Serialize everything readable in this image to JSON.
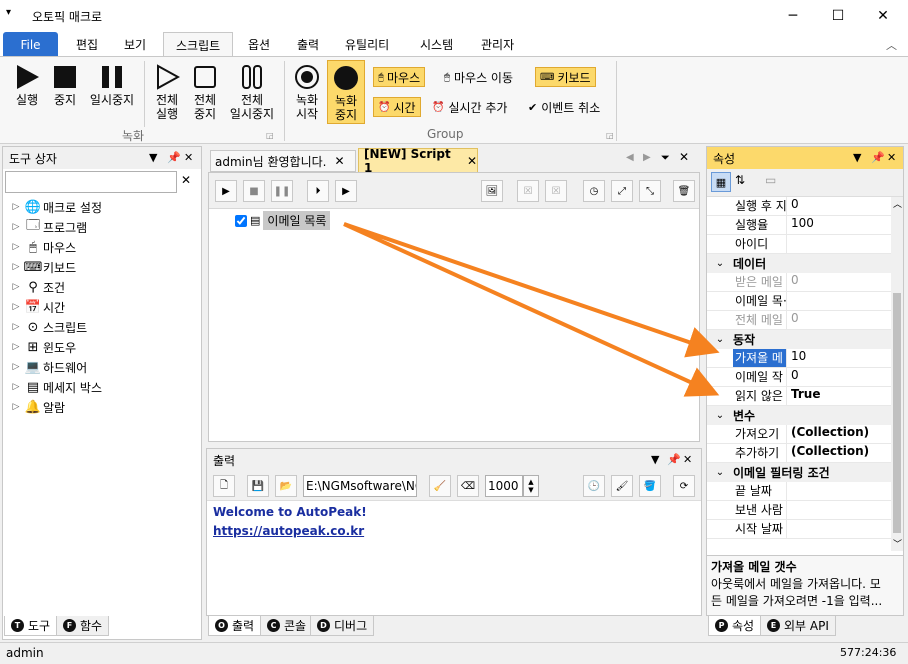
{
  "window": {
    "title": "오토픽 매크로",
    "min": "─",
    "max": "☐",
    "close": "✕"
  },
  "menu": {
    "tabs": [
      "File",
      "편집",
      "보기",
      "스크립트",
      "옵션",
      "출력",
      "유틸리티",
      "시스템",
      "관리자"
    ]
  },
  "ribbon": {
    "run": "실행",
    "stop": "중지",
    "pause": "일시중지",
    "all_run": [
      "전체",
      "실행"
    ],
    "all_stop": [
      "전체",
      "중지"
    ],
    "all_pause": [
      "전체",
      "일시중지"
    ],
    "rec_start": [
      "녹화",
      "시작"
    ],
    "rec_stop": [
      "녹화",
      "중지"
    ],
    "group_record": "녹화",
    "group_group": "Group",
    "mouse": "마우스",
    "mouse_move": "마우스 이동",
    "keyboard": "키보드",
    "time": "시간",
    "realtime_add": "실시간 추가",
    "cancel_event": "이벤트 취소"
  },
  "toolbox": {
    "title": "도구 상자",
    "items": [
      "매크로 설정",
      "프로그램",
      "마우스",
      "키보드",
      "조건",
      "시간",
      "스크립트",
      "윈도우",
      "하드웨어",
      "메세지 박스",
      "알람"
    ],
    "tab_tools": "도구",
    "tab_functions": "함수"
  },
  "editor": {
    "tab1": "admin님 환영합니다.",
    "tab2": "[NEW] Script 1",
    "node": "이메일 목록"
  },
  "output": {
    "title": "출력",
    "path": "E:\\NGMsoftware\\NG",
    "count": "1000",
    "line1": "Welcome to AutoPeak!",
    "line2": "https://autopeak.co.kr",
    "tab_output": "출력",
    "tab_console": "콘솔",
    "tab_debug": "디버그"
  },
  "props": {
    "title": "속성",
    "rows_top": [
      {
        "n": "실행 후 지",
        "v": "0"
      },
      {
        "n": "실행율",
        "v": "100"
      },
      {
        "n": "아이디",
        "v": ""
      }
    ],
    "cat_data": "데이터",
    "rows_data": [
      {
        "n": "받은 메일",
        "v": "0"
      },
      {
        "n": "이메일 목·",
        "v": ""
      },
      {
        "n": "전체 메일",
        "v": "0"
      }
    ],
    "cat_action": "동작",
    "rows_action": [
      {
        "n": "가져올 메",
        "v": "10"
      },
      {
        "n": "이메일 작",
        "v": "0"
      },
      {
        "n": "읽지 않은",
        "v": "True"
      }
    ],
    "cat_var": "변수",
    "rows_var": [
      {
        "n": "가져오기",
        "v": "(Collection)"
      },
      {
        "n": "추가하기",
        "v": "(Collection)"
      }
    ],
    "cat_filter": "이메일 필터링 조건",
    "rows_filter": [
      {
        "n": "끝 날짜",
        "v": ""
      },
      {
        "n": "보낸 사람",
        "v": ""
      },
      {
        "n": "시작 날짜",
        "v": ""
      }
    ],
    "desc_title": "가져올 메일 갯수",
    "desc_text": [
      "아웃룩에서 메일을 가져옵니다. 모",
      "든 메일을 가져오려면 -1을 입력..."
    ],
    "tab_props": "속성",
    "tab_api": "외부 API"
  },
  "status": {
    "user": "admin",
    "time": "577:24:36"
  },
  "colors": {
    "accent": "#2b6fd0",
    "arrow": "#f58220",
    "highlight": "#fcd96b"
  }
}
